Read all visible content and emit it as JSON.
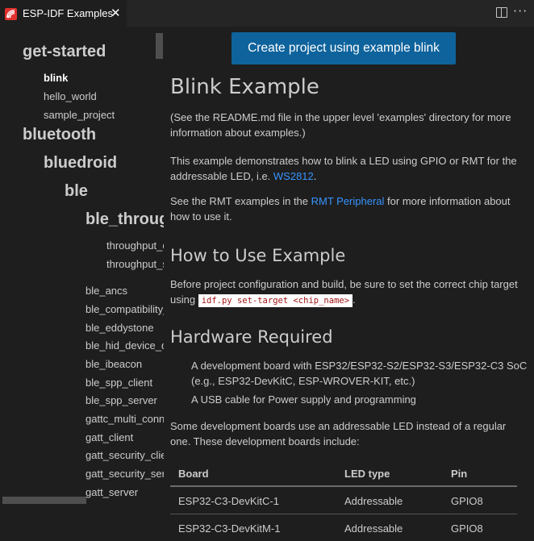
{
  "tab": {
    "title": "ESP-IDF Examples",
    "close": "✕",
    "icon": "esp-idf-logo-icon"
  },
  "toolbar": {
    "split_icon": "split-editor-icon",
    "more": "···"
  },
  "sidebar": {
    "items": [
      {
        "label": "get-started",
        "kind": "h1"
      },
      {
        "label": "blink",
        "kind": "leaf",
        "active": true
      },
      {
        "label": "hello_world",
        "kind": "leaf"
      },
      {
        "label": "sample_project",
        "kind": "leaf"
      },
      {
        "label": "bluetooth",
        "kind": "h1"
      },
      {
        "label": "bluedroid",
        "kind": "h1"
      },
      {
        "label": "ble",
        "kind": "h1"
      },
      {
        "label": "ble_throughput",
        "kind": "h1"
      },
      {
        "label": "throughput_client",
        "kind": "leaf"
      },
      {
        "label": "throughput_server",
        "kind": "leaf"
      },
      {
        "label": "ble_ancs",
        "kind": "leaf"
      },
      {
        "label": "ble_compatibility_test",
        "kind": "leaf"
      },
      {
        "label": "ble_eddystone",
        "kind": "leaf"
      },
      {
        "label": "ble_hid_device_demo",
        "kind": "leaf"
      },
      {
        "label": "ble_ibeacon",
        "kind": "leaf"
      },
      {
        "label": "ble_spp_client",
        "kind": "leaf"
      },
      {
        "label": "ble_spp_server",
        "kind": "leaf"
      },
      {
        "label": "gattc_multi_connect",
        "kind": "leaf"
      },
      {
        "label": "gatt_client",
        "kind": "leaf"
      },
      {
        "label": "gatt_security_client",
        "kind": "leaf"
      },
      {
        "label": "gatt_security_server",
        "kind": "leaf"
      },
      {
        "label": "gatt_server",
        "kind": "leaf"
      }
    ]
  },
  "main": {
    "create_button": "Create project using example blink",
    "title": "Blink Example",
    "p1": "(See the README.md file in the upper level 'examples' directory for more information about examples.)",
    "p2_text": "This example demonstrates how to blink a LED using GPIO or RMT for the addressable LED, i.e. ",
    "p2_link": "WS2812",
    "p2_end": ".",
    "p3_text": "See the RMT examples in the ",
    "p3_link": "RMT Peripheral",
    "p3_end": " for more information about how to use it.",
    "h_use": "How to Use Example",
    "p4_text": "Before project configuration and build, be sure to set the correct chip target using ",
    "p4_code": "idf.py set-target <chip_name>",
    "p4_end": ".",
    "h_hw": "Hardware Required",
    "bullets": [
      "A development board with ESP32/ESP32-S2/ESP32-S3/ESP32-C3 SoC (e.g., ESP32-DevKitC, ESP-WROVER-KIT, etc.)",
      "A USB cable for Power supply and programming"
    ],
    "p5": "Some development boards use an addressable LED instead of a regular one. These development boards include:",
    "table": {
      "headers": [
        "Board",
        "LED type",
        "Pin"
      ],
      "rows": [
        [
          "ESP32-C3-DevKitC-1",
          "Addressable",
          "GPIO8"
        ],
        [
          "ESP32-C3-DevKitM-1",
          "Addressable",
          "GPIO8"
        ]
      ]
    }
  }
}
